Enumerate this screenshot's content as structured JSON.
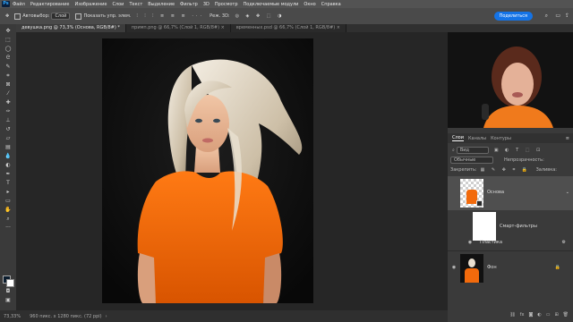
{
  "menu": {
    "logo": "Ps",
    "items": [
      "Файл",
      "Редактирование",
      "Изображение",
      "Слои",
      "Текст",
      "Выделение",
      "Фильтр",
      "3D",
      "Просмотр",
      "Подключаемые модули",
      "Окно",
      "Справка"
    ]
  },
  "options": {
    "autoselect_label": "Автовыбор:",
    "autoselect_value": "Слой",
    "show_controls_label": "Показать упр. элем.",
    "mode_label": "Реж. 3D:",
    "share_label": "Поделиться"
  },
  "tabs": [
    {
      "label": "девушка.png @ 73,3% (Основа, RGB/8#) *",
      "active": true
    },
    {
      "label": "примп.png @ 66,7% (Слой 1, RGB/8#) ×",
      "active": false
    },
    {
      "label": "временных.psd @ 66,7% (Слой 1, RGB/8#) ×",
      "active": false
    }
  ],
  "status": {
    "zoom": "73,33%",
    "size": "960 пикс. x 1280 пикс. (72 ppi)"
  },
  "layers_panel": {
    "tabs": [
      "Слои",
      "Каналы",
      "Контуры"
    ],
    "kind_label": "Вид",
    "blend_mode": "Обычные",
    "opacity_label": "Непрозрачность:",
    "lock_label": "Закрепить:",
    "fill_label": "Заливка:",
    "layers": [
      {
        "name": "Основа",
        "type": "smart"
      },
      {
        "name": "Смарт-фильтры",
        "type": "filter-mask"
      },
      {
        "name": "Пластика",
        "type": "filter"
      },
      {
        "name": "Фон",
        "type": "image"
      }
    ]
  },
  "colors": {
    "accent": "#1473e6",
    "tshirt": "#f26a0c",
    "background": "#1e1e1e"
  }
}
